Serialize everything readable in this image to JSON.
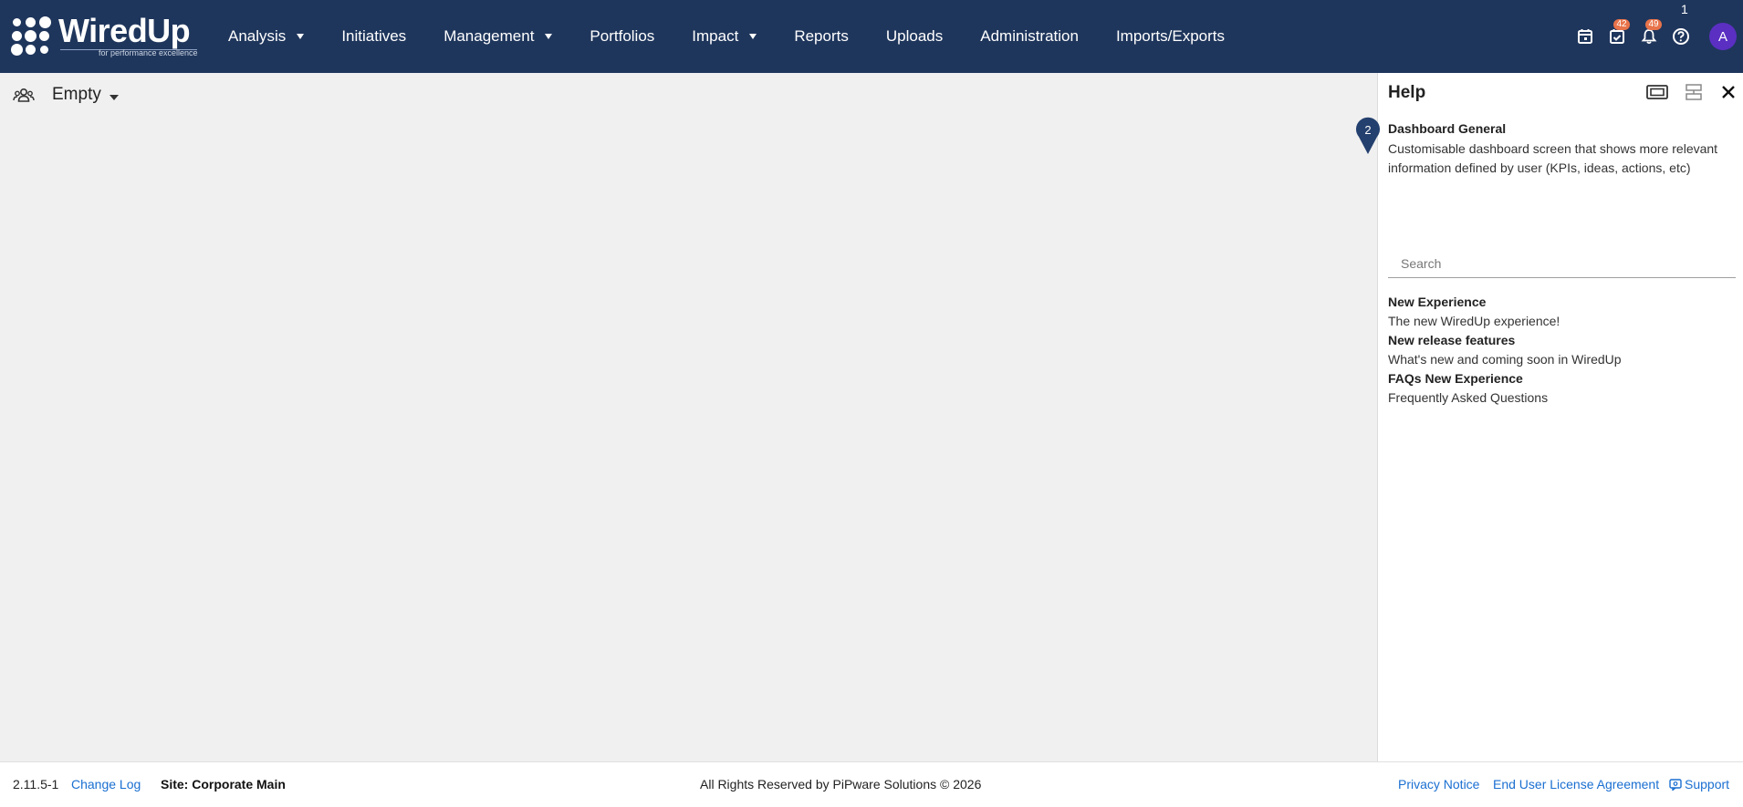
{
  "app": {
    "logo_text": "WiredUp",
    "logo_tagline": "for performance excellence"
  },
  "nav": {
    "items": [
      {
        "label": "Analysis",
        "dropdown": true
      },
      {
        "label": "Initiatives",
        "dropdown": false
      },
      {
        "label": "Management",
        "dropdown": true
      },
      {
        "label": "Portfolios",
        "dropdown": false
      },
      {
        "label": "Impact",
        "dropdown": true
      },
      {
        "label": "Reports",
        "dropdown": false
      },
      {
        "label": "Uploads",
        "dropdown": false
      },
      {
        "label": "Administration",
        "dropdown": false
      },
      {
        "label": "Imports/Exports",
        "dropdown": false
      }
    ]
  },
  "toolbar": {
    "calendar_icon": "calendar-icon",
    "tasks_icon": "task-check-icon",
    "tasks_badge": "42",
    "notifications_icon": "bell-icon",
    "notifications_badge": "49",
    "help_icon": "help-circle-icon",
    "help_count": "1",
    "avatar_initial": "A",
    "avatar_color": "#5a2fc2",
    "badge_color": "#e8734a"
  },
  "dashboard": {
    "selector_icon": "people-group-icon",
    "selected": "Empty"
  },
  "help": {
    "title": "Help",
    "marker_number": "2",
    "context_title": "Dashboard General",
    "context_description": "Customisable dashboard screen that shows more relevant information defined by user (KPIs, ideas, actions, etc)",
    "search_placeholder": "Search",
    "articles": [
      {
        "title": "New Experience",
        "description": "The new WiredUp experience!"
      },
      {
        "title": "New release features",
        "description": "What's new and coming soon in WiredUp"
      },
      {
        "title": "FAQs New Experience",
        "description": "Frequently Asked Questions"
      }
    ]
  },
  "footer": {
    "version": "2.11.5-1",
    "change_log": "Change Log",
    "site": "Site: Corporate Main",
    "copyright": "All Rights Reserved by PiPware Solutions © 2026",
    "privacy": "Privacy Notice",
    "eula": "End User License Agreement",
    "support": "Support"
  },
  "colors": {
    "topbar": "#1f365c",
    "link": "#1a6fd1",
    "background": "#f0f0f0"
  }
}
